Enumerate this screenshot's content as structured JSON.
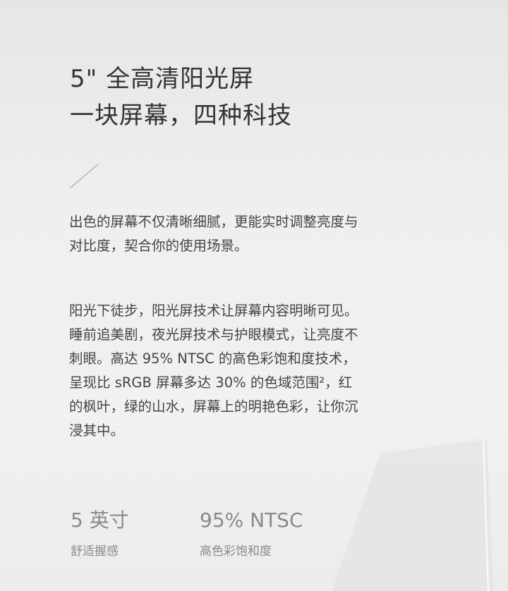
{
  "headline": {
    "line1": "5\" 全高清阳光屏",
    "line2": "一块屏幕，四种科技"
  },
  "paragraph1": {
    "lines": [
      "出色的屏幕不仅清晰细腻，更能实时调整亮度与",
      "对比度，契合你的使用场景。"
    ]
  },
  "paragraph2": {
    "lines": [
      "阳光下徒步，阳光屏技术让屏幕内容明晰可见。",
      "睡前追美剧，夜光屏技术与护眼模式，让亮度不",
      "刺眼。高达 95% NTSC 的高色彩饱和度技术，",
      "呈现比 sRGB 屏幕多达 30% 的色域范围²，红",
      "的枫叶，绿的山水，屏幕上的明艳色彩，让你沉",
      "浸其中。"
    ]
  },
  "stats": [
    {
      "value": "5 英寸",
      "label": "舒适握感"
    },
    {
      "value": "95% NTSC",
      "label": "高色彩饱和度"
    }
  ],
  "colors": {
    "background": "#eaeaea",
    "text": "#3a3a3a",
    "muted": "#8a8a8a"
  }
}
